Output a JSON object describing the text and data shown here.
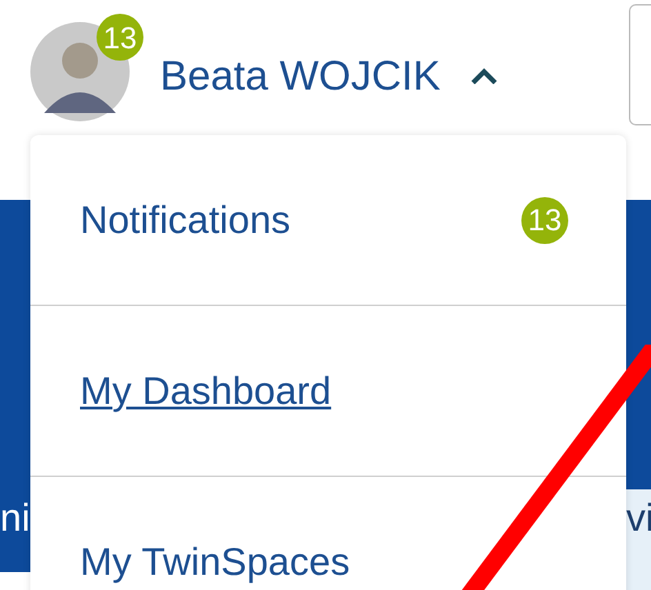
{
  "user": {
    "name": "Beata WOJCIK",
    "badge": "13",
    "expanded": true
  },
  "menu": {
    "items": [
      {
        "label": "Notifications",
        "badge": "13",
        "hovered": false
      },
      {
        "label": "My Dashboard",
        "hovered": true
      },
      {
        "label": "My TwinSpaces",
        "hovered": false
      }
    ]
  },
  "background": {
    "fragments": [
      {
        "text": "ni",
        "kind": "dark"
      },
      {
        "text": "vi",
        "kind": "light"
      }
    ]
  }
}
